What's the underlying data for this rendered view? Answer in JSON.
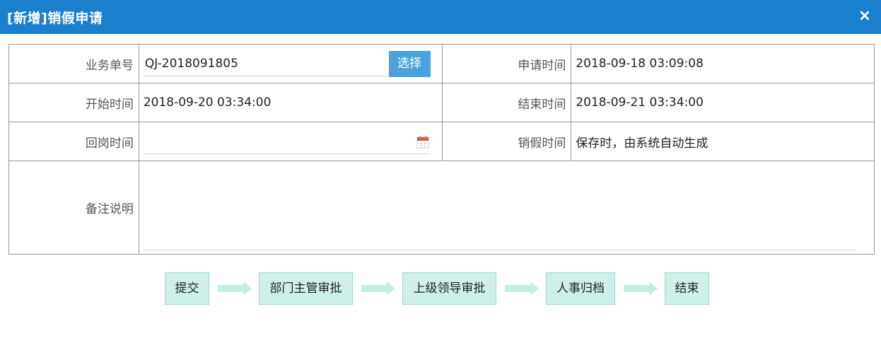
{
  "dialog": {
    "title": "[新增]销假申请",
    "close_icon": "×"
  },
  "form": {
    "business_no": {
      "label": "业务单号",
      "value": "QJ-2018091805",
      "button_label": "选择"
    },
    "apply_time": {
      "label": "申请时间",
      "value": "2018-09-18 03:09:08"
    },
    "start_time": {
      "label": "开始时间",
      "value": "2018-09-20 03:34:00"
    },
    "end_time": {
      "label": "结束时间",
      "value": "2018-09-21 03:34:00"
    },
    "return_time": {
      "label": "回岗时间",
      "value": "",
      "icon": "calendar-icon"
    },
    "cancel_time": {
      "label": "销假时间",
      "value": "保存时，由系统自动生成"
    },
    "remarks": {
      "label": "备注说明",
      "value": ""
    }
  },
  "workflow": {
    "steps": [
      "提交",
      "部门主管审批",
      "上级领导审批",
      "人事归档",
      "结束"
    ]
  },
  "colors": {
    "title_bar": "#1a7fcd",
    "select_button": "#4aa3dc",
    "step_fill": "#cdf0ea",
    "step_border": "#9ed9cd",
    "arrow": "#c5ede7"
  }
}
